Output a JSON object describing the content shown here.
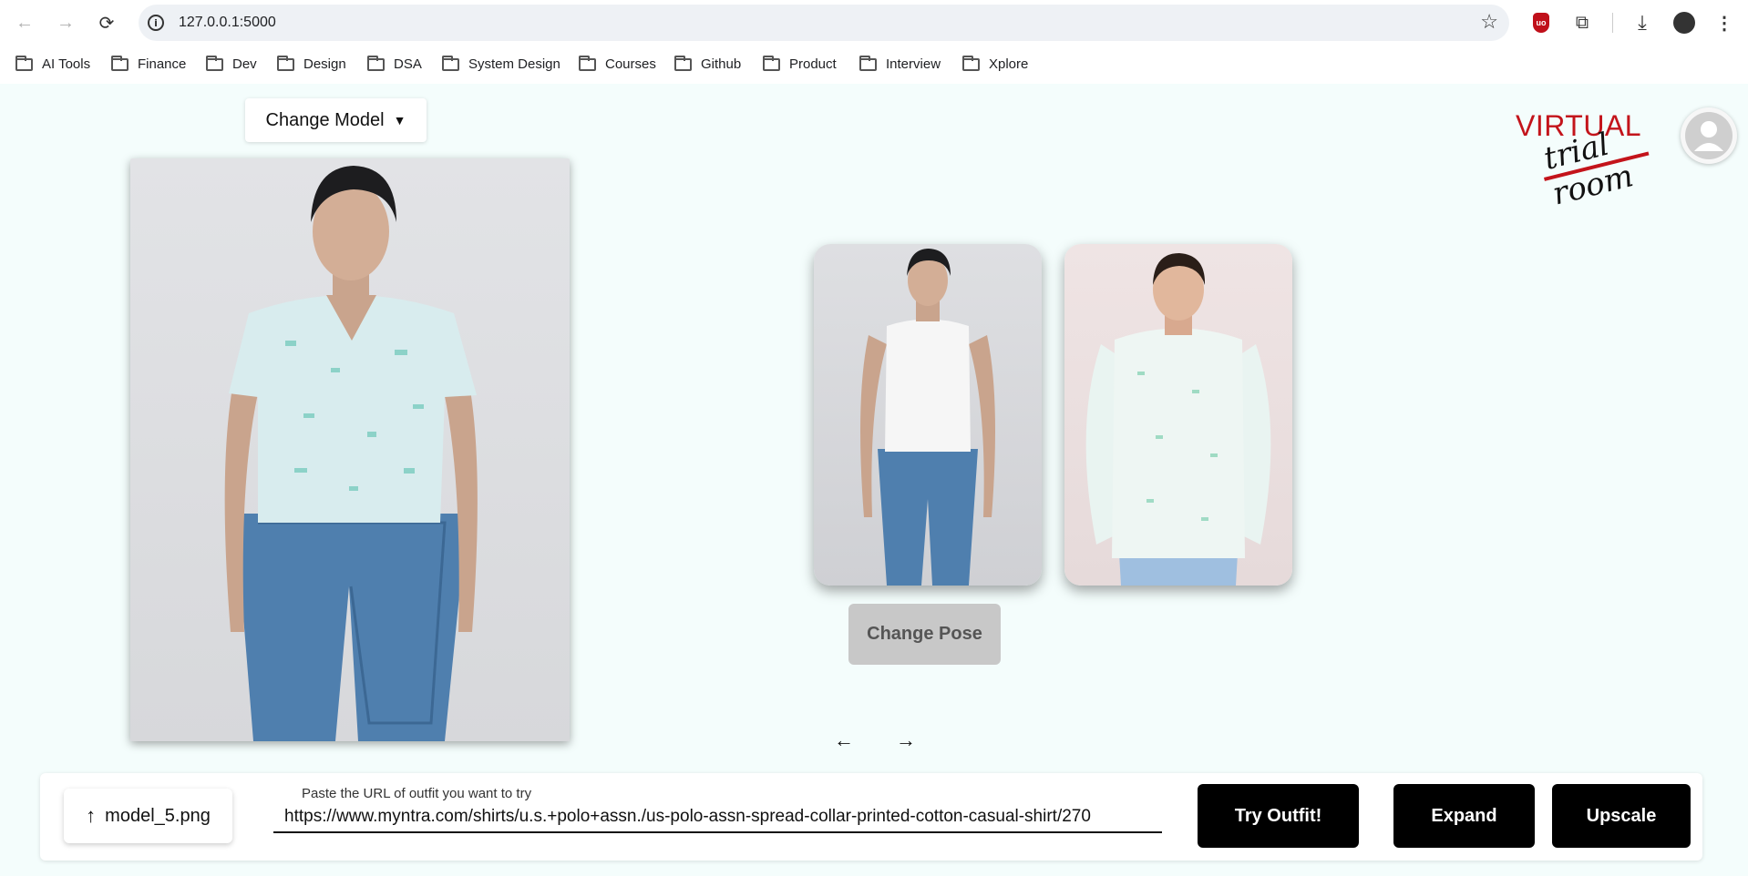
{
  "browser": {
    "url": "127.0.0.1:5000",
    "bookmarks": [
      "AI Tools",
      "Finance",
      "Dev",
      "Design",
      "DSA",
      "System Design",
      "Courses",
      "Github",
      "Product",
      "Interview",
      "Xplore"
    ]
  },
  "header": {
    "change_model_label": "Change Model",
    "logo_line1": "VIRTUAL",
    "logo_line2": "trial room"
  },
  "poses": {
    "change_pose_label": "Change Pose"
  },
  "controls": {
    "upload_file_name": "model_5.png",
    "url_label": "Paste the URL of outfit you want to try",
    "url_value": "https://www.myntra.com/shirts/u.s.+polo+assn./us-polo-assn-spread-collar-printed-cotton-casual-shirt/270",
    "try_outfit_label": "Try Outfit!",
    "expand_label": "Expand",
    "upscale_label": "Upscale"
  },
  "colors": {
    "page_bg": "#f4fdfc",
    "brand_red": "#c3141b",
    "button_dark": "#000000",
    "button_disabled": "#c8c8c8"
  }
}
